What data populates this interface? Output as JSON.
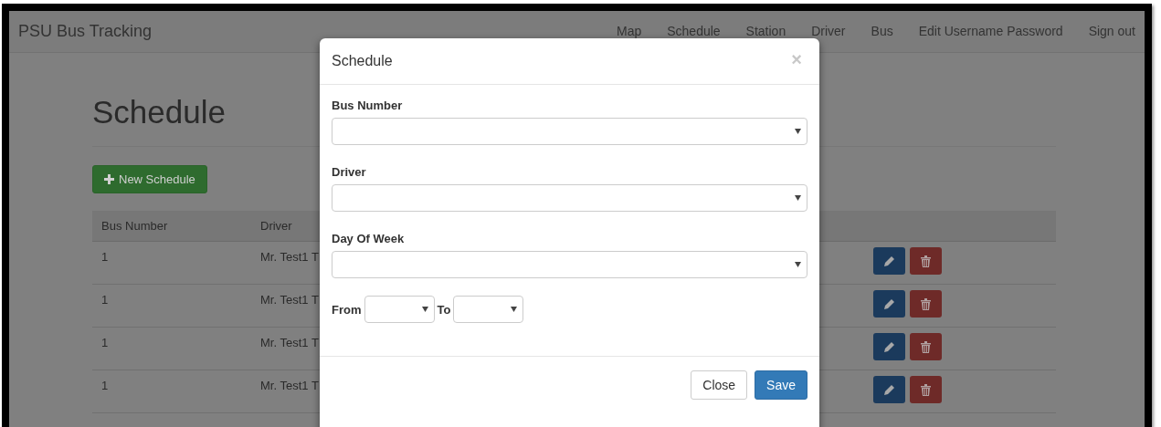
{
  "navbar": {
    "brand": "PSU Bus Tracking",
    "links": [
      {
        "label": "Map"
      },
      {
        "label": "Schedule"
      },
      {
        "label": "Station"
      },
      {
        "label": "Driver"
      },
      {
        "label": "Bus"
      },
      {
        "label": "Edit Username Password"
      },
      {
        "label": "Sign out"
      }
    ]
  },
  "page": {
    "heading": "Schedule",
    "new_button": "New Schedule"
  },
  "table": {
    "columns": [
      "Bus Number",
      "Driver"
    ],
    "rows": [
      {
        "cells": [
          "1",
          "Mr. Test1 T"
        ]
      },
      {
        "cells": [
          "1",
          "Mr. Test1 T"
        ]
      },
      {
        "cells": [
          "1",
          "Mr. Test1 T"
        ]
      },
      {
        "cells": [
          "1",
          "Mr. Test1 T"
        ]
      }
    ]
  },
  "modal": {
    "title": "Schedule",
    "close_symbol": "×",
    "fields": [
      {
        "label": "Bus Number"
      },
      {
        "label": "Driver"
      },
      {
        "label": "Day Of Week"
      }
    ],
    "time_range": {
      "from_label": "From",
      "to_label": "To"
    },
    "buttons": [
      {
        "label": "Close",
        "kind": "default"
      },
      {
        "label": "Save",
        "kind": "primary"
      }
    ]
  }
}
